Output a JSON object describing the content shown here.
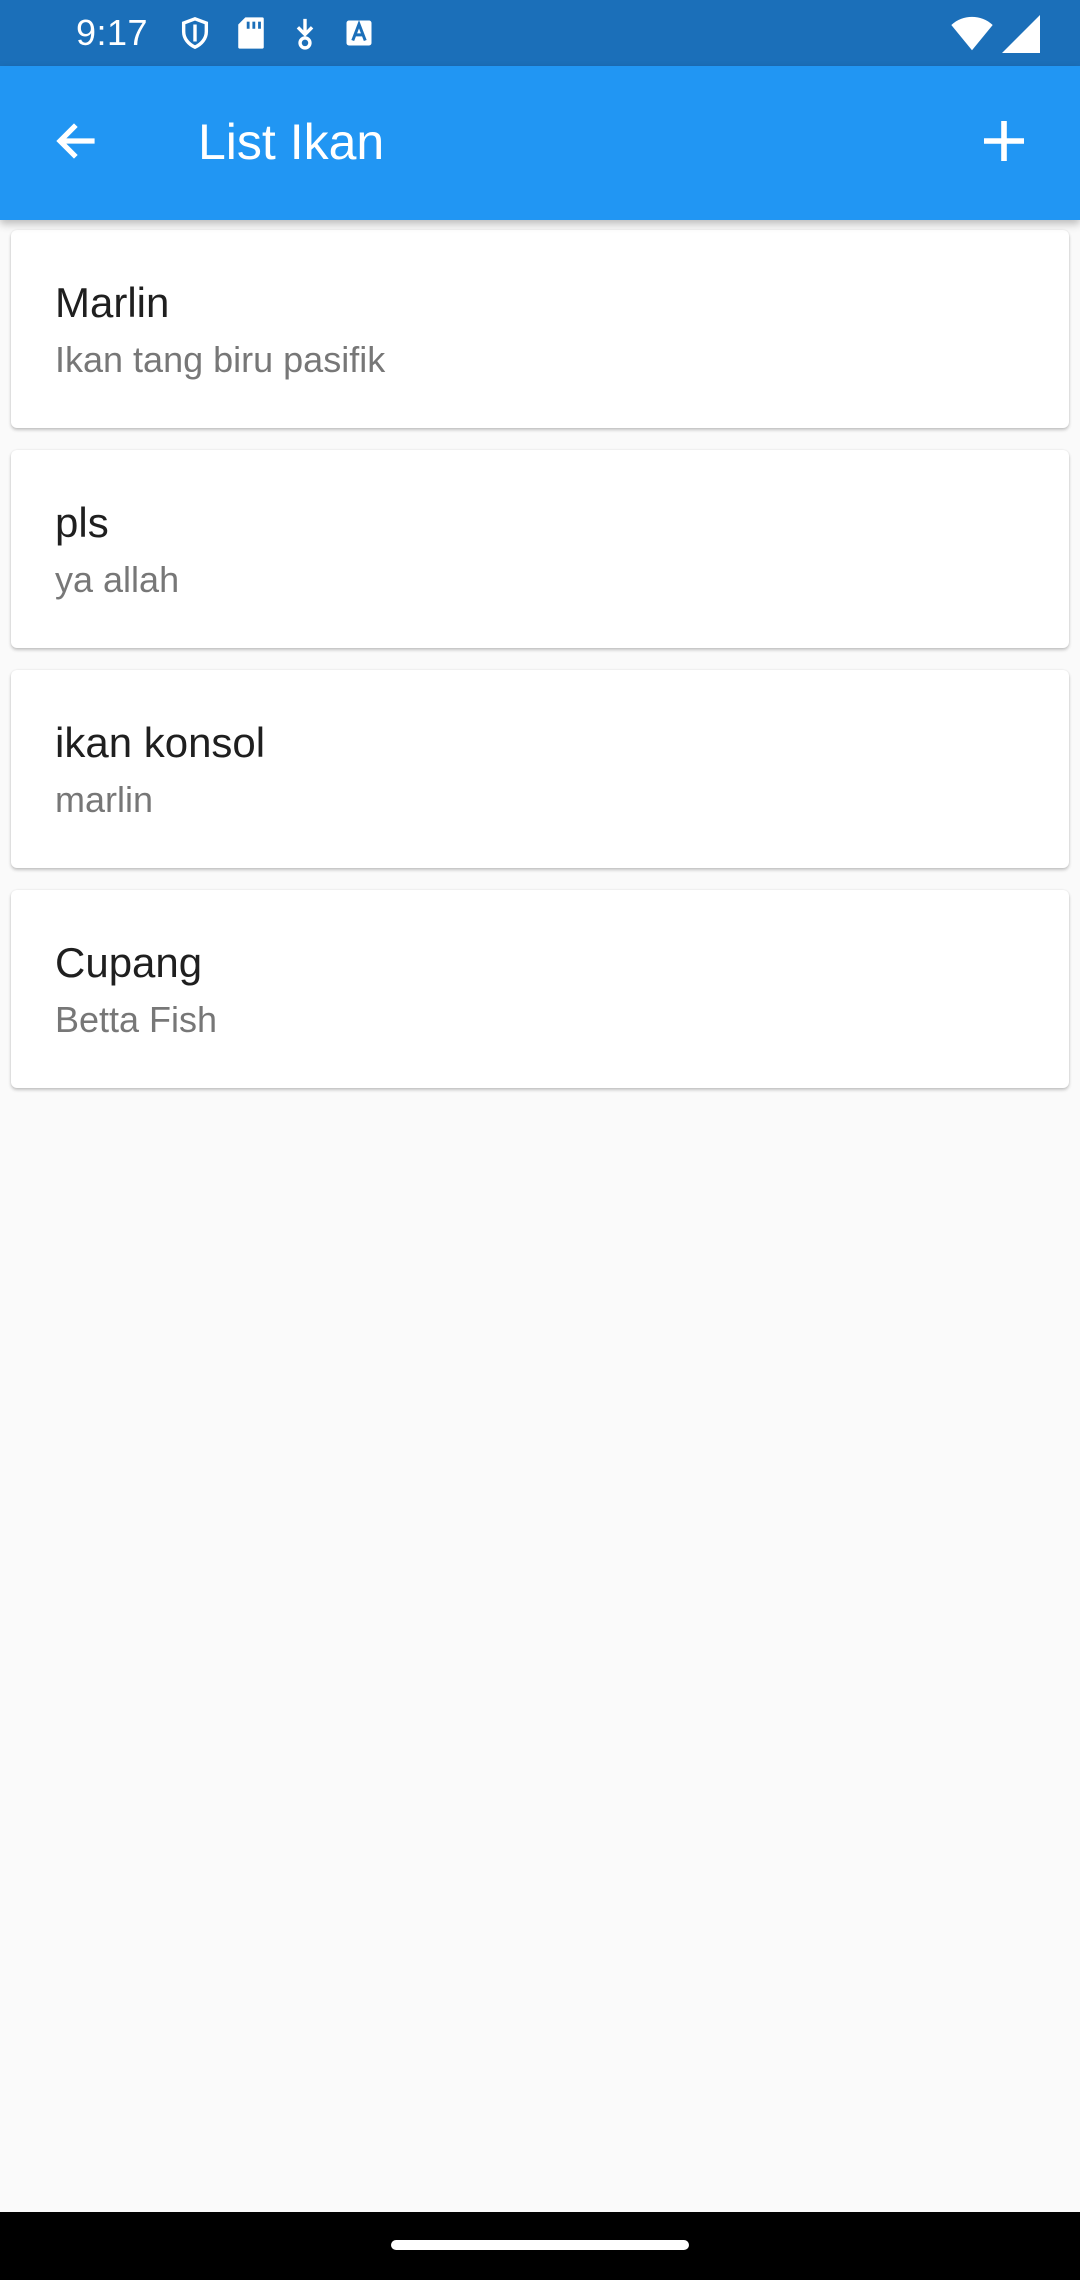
{
  "status_bar": {
    "time": "9:17",
    "icons": [
      "shield-icon",
      "sd-card-icon",
      "download-icon",
      "text-a-icon",
      "wifi-icon",
      "cell-signal-icon"
    ]
  },
  "app_bar": {
    "title": "List Ikan",
    "back_icon": "arrow-back-icon",
    "add_icon": "plus-icon"
  },
  "list": {
    "items": [
      {
        "title": "Marlin",
        "subtitle": "Ikan tang biru pasifik"
      },
      {
        "title": "pls",
        "subtitle": "ya allah"
      },
      {
        "title": "ikan konsol",
        "subtitle": "marlin"
      },
      {
        "title": "Cupang",
        "subtitle": "Betta Fish"
      }
    ]
  },
  "colors": {
    "status_bar": "#1b6fb9",
    "app_bar": "#2196f3",
    "background": "#fafafa",
    "card": "#ffffff",
    "title_text": "#1f1f1f",
    "subtitle_text": "#777777"
  }
}
